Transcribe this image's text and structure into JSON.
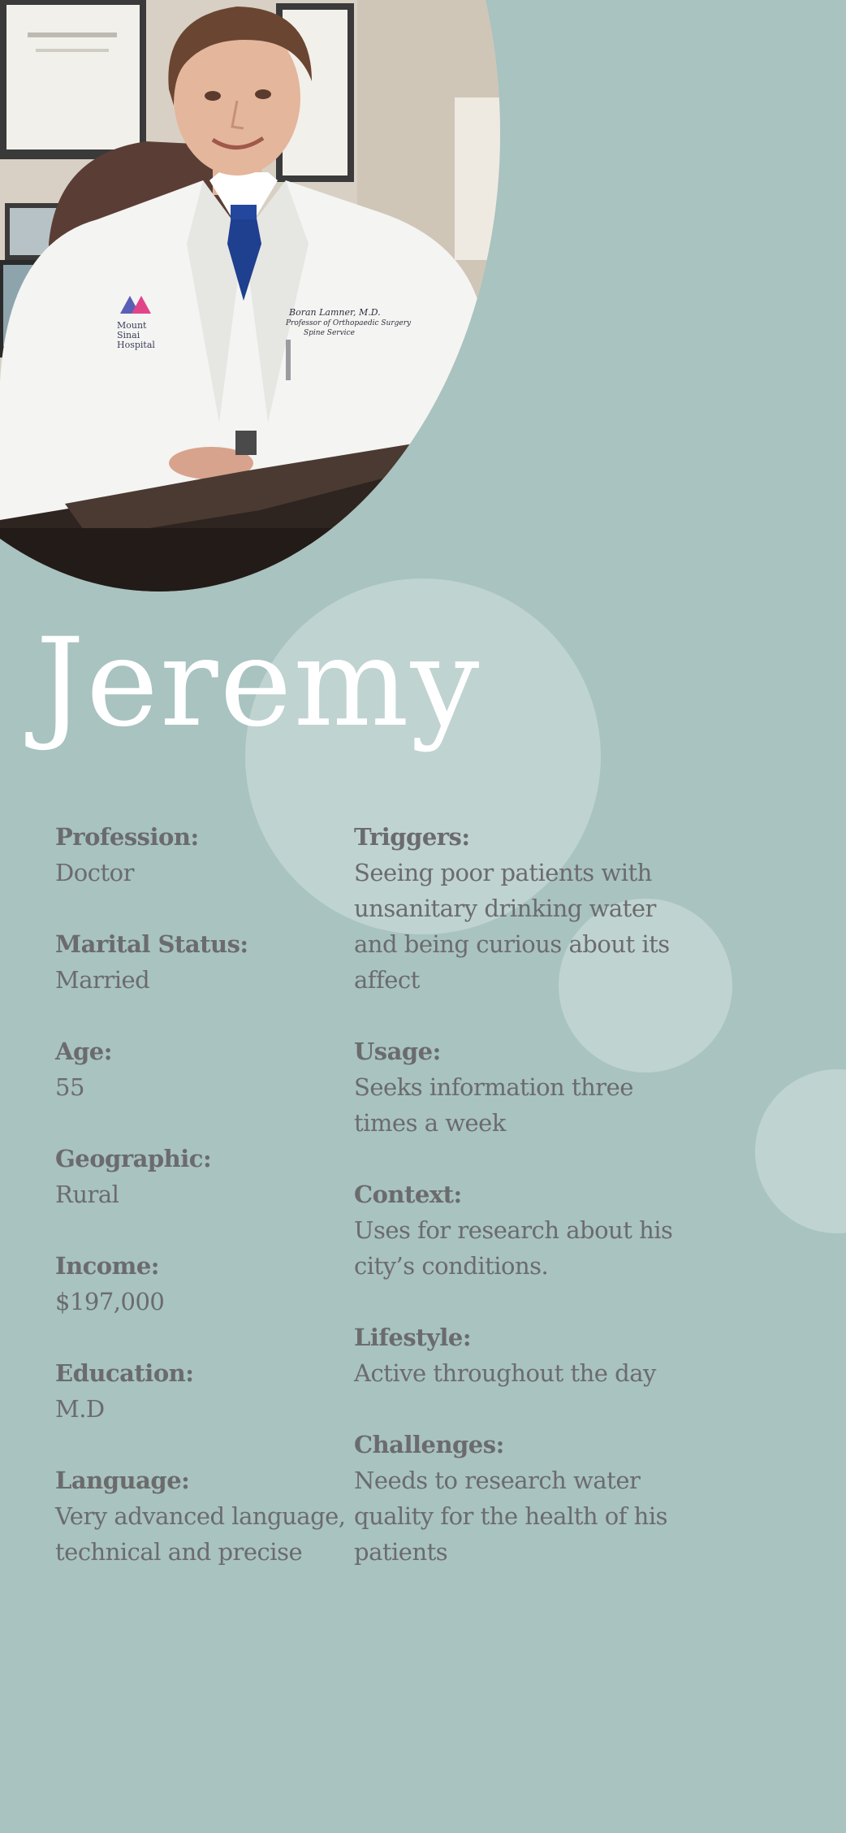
{
  "persona": {
    "name": "Jeremy",
    "photo": {
      "icon": "doctor-portrait-photo",
      "coat_text": [
        "Boran Lamner, M.D.",
        "Professor of Orthopaedic Surgery",
        "Spine Service"
      ],
      "logo_text": [
        "Mount",
        "Sinai",
        "Hospital"
      ]
    },
    "left_fields": [
      {
        "label": "Profession:",
        "value": "Doctor"
      },
      {
        "label": "Marital Status:",
        "value": "Married"
      },
      {
        "label": "Age:",
        "value": "55"
      },
      {
        "label": "Geographic:",
        "value": "Rural"
      },
      {
        "label": "Income:",
        "value": "$197,000"
      },
      {
        "label": "Education:",
        "value": "M.D"
      },
      {
        "label": "Language:",
        "value": "Very advanced language, technical and precise"
      }
    ],
    "right_fields": [
      {
        "label": "Triggers:",
        "value": "Seeing poor patients with unsanitary drinking water and being curious about its affect"
      },
      {
        "label": "Usage:",
        "value": "Seeks information three times a week"
      },
      {
        "label": "Context:",
        "value": "Uses for research about his city’s conditions."
      },
      {
        "label": "Lifestyle:",
        "value": "Active throughout the day"
      },
      {
        "label": "Challenges:",
        "value": "Needs to research water quality for the health of his patients"
      }
    ]
  },
  "colors": {
    "background": "#a8c3c0",
    "circle": "#bfd3d1",
    "text": "#6b6b6d",
    "name": "#ffffff"
  }
}
